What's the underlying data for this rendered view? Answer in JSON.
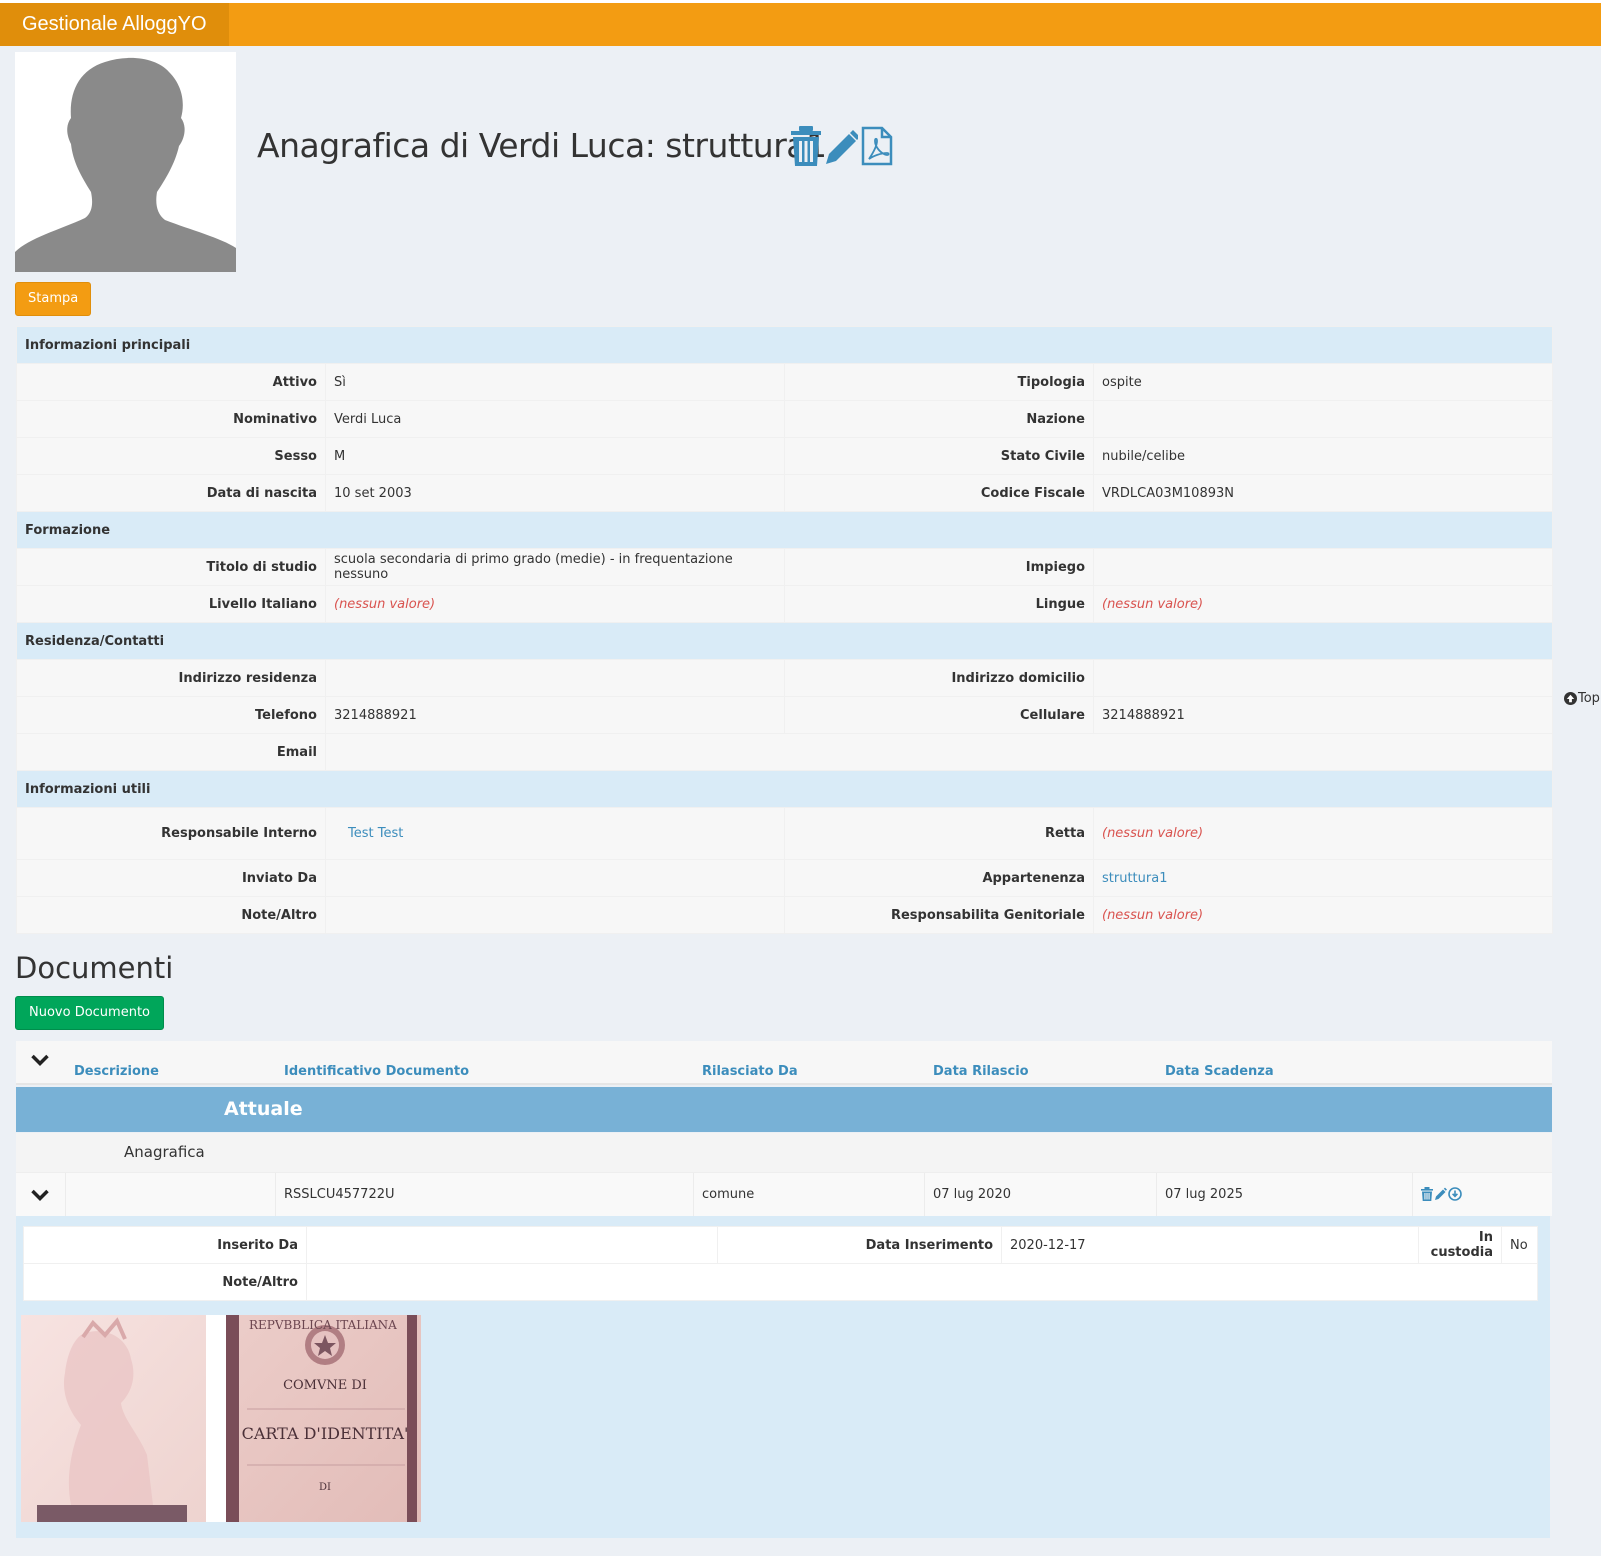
{
  "app": {
    "brand": "Gestionale AlloggYO"
  },
  "header": {
    "title": "Anagrafica di Verdi Luca: struttura1"
  },
  "actions": {
    "stampa": "Stampa"
  },
  "sections": {
    "principali": {
      "title": "Informazioni principali",
      "rows": [
        {
          "l1": "Attivo",
          "v1": "Sì",
          "l2": "Tipologia",
          "v2": "ospite"
        },
        {
          "l1": "Nominativo",
          "v1": "Verdi Luca",
          "l2": "Nazione",
          "v2": ""
        },
        {
          "l1": "Sesso",
          "v1": "M",
          "l2": "Stato Civile",
          "v2": "nubile/celibe"
        },
        {
          "l1": "Data di nascita",
          "v1": "10 set 2003",
          "l2": "Codice Fiscale",
          "v2": "VRDLCA03M10893N"
        }
      ]
    },
    "formazione": {
      "title": "Formazione",
      "rows": [
        {
          "l1": "Titolo di studio",
          "v1": "scuola secondaria di primo grado (medie) - in frequentazione nessuno",
          "l2": "Impiego",
          "v2": ""
        },
        {
          "l1": "Livello Italiano",
          "v1": "(nessun valore)",
          "l2": "Lingue",
          "v2": "(nessun valore)"
        }
      ]
    },
    "residenza": {
      "title": "Residenza/Contatti",
      "rows": [
        {
          "l1": "Indirizzo residenza",
          "v1": "",
          "l2": "Indirizzo domicilio",
          "v2": ""
        },
        {
          "l1": "Telefono",
          "v1": "3214888921",
          "l2": "Cellulare",
          "v2": "3214888921"
        }
      ],
      "email_label": "Email",
      "email_value": ""
    },
    "utili": {
      "title": "Informazioni utili",
      "rows": [
        {
          "l1": "Responsabile Interno",
          "v1": "Test Test",
          "l2": "Retta",
          "v2": "(nessun valore)"
        },
        {
          "l1": "Inviato Da",
          "v1": "",
          "l2": "Appartenenza",
          "v2": "struttura1"
        },
        {
          "l1": "Note/Altro",
          "v1": "",
          "l2": "Responsabilita Genitoriale",
          "v2": "(nessun valore)"
        }
      ]
    }
  },
  "top_link": "Top",
  "documents": {
    "title": "Documenti",
    "new_button": "Nuovo Documento",
    "columns": [
      "Descrizione",
      "Identificativo Documento",
      "Rilasciato Da",
      "Data Rilascio",
      "Data Scadenza"
    ],
    "group": "Attuale",
    "subgroup": "Anagrafica",
    "row": {
      "descrizione": "",
      "identificativo": "RSSLCU457722U",
      "rilasciato_da": "comune",
      "data_rilascio": "07 lug 2020",
      "data_scadenza": "07 lug 2025"
    },
    "detail": {
      "inserito_da_label": "Inserito Da",
      "inserito_da_value": "",
      "data_inserimento_label": "Data Inserimento",
      "data_inserimento_value": "2020-12-17",
      "in_custodia_label": "In custodia",
      "in_custodia_value": "No",
      "note_label": "Note/Altro",
      "note_value": ""
    },
    "card_text": {
      "arc": "REPVBBLICA ITALIANA",
      "line1": "COMVNE DI",
      "line2": "CARTA D'IDENTITA'",
      "line3": "DI"
    }
  },
  "colors": {
    "navbar": "#f39c12",
    "section_bg": "#d9ebf7",
    "group_bg": "#78b1d6",
    "link": "#3c8dbc",
    "empty": "#d9534f",
    "success": "#00a65a"
  },
  "icons": [
    "trash-icon",
    "pencil-icon",
    "pdf-icon",
    "chevron-down-icon",
    "arrow-up-circle-icon",
    "download-circle-icon"
  ]
}
